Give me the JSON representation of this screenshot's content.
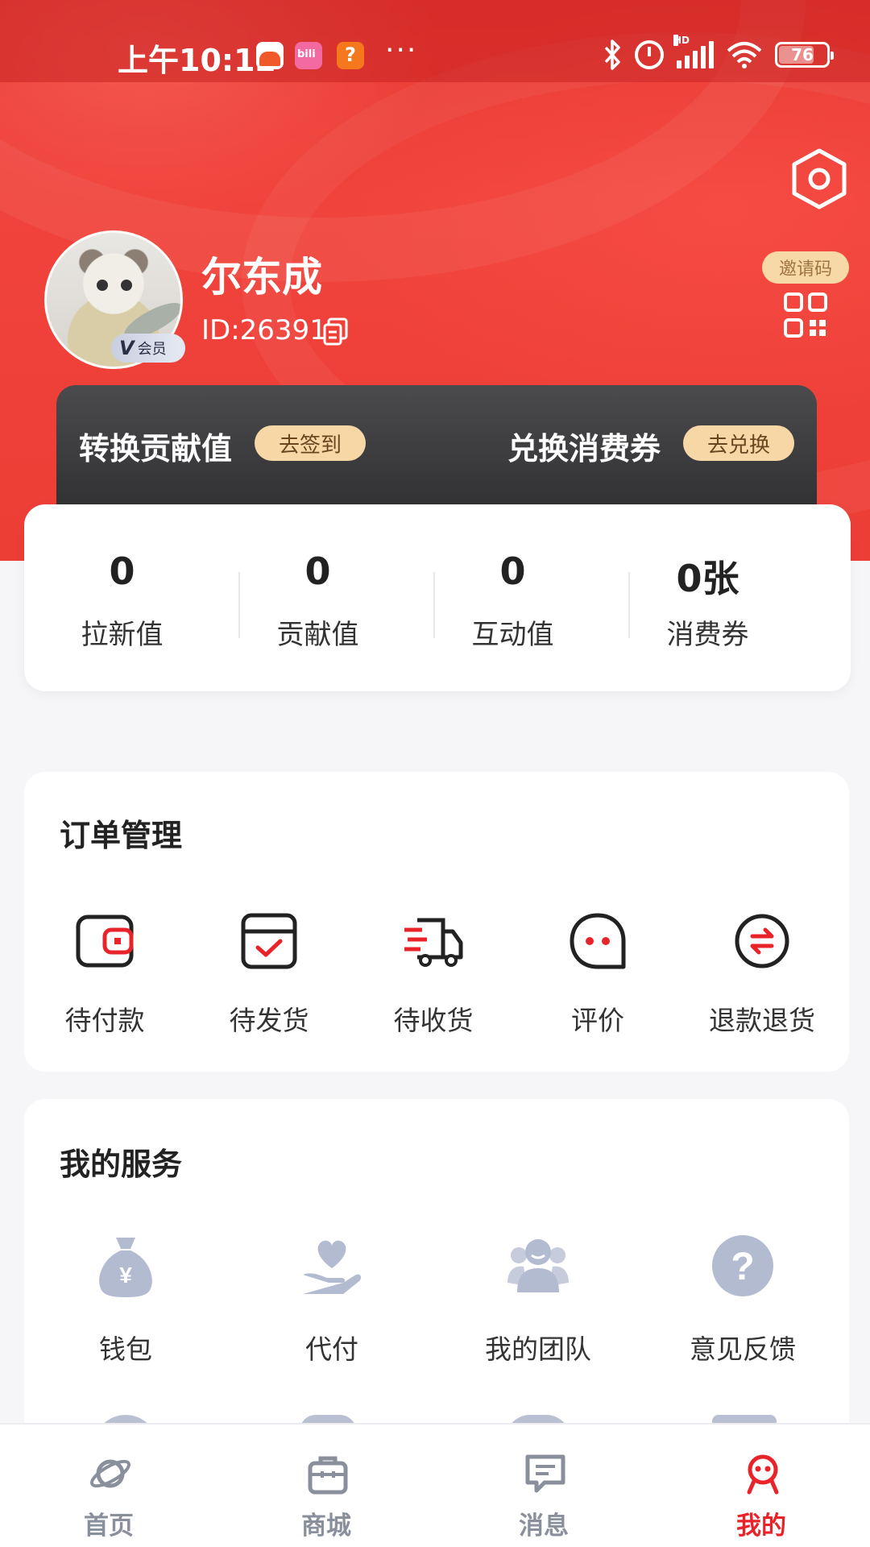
{
  "status_bar": {
    "time": "上午10:12",
    "battery": "76",
    "battery_fraction": 0.76,
    "signal_label": "HD",
    "icons": [
      "app-icon-orange",
      "bilibili-icon",
      "app-icon-question",
      "more-dots-icon",
      "bluetooth-icon",
      "alarm-icon",
      "signal-icon",
      "wifi-icon",
      "battery-icon"
    ]
  },
  "profile": {
    "name": "尔东成",
    "id_text": "ID:26391",
    "vip_letter": "V",
    "vip_label": "会员",
    "invite_label": "邀请码"
  },
  "promo": {
    "left_label": "转换贡献值",
    "left_button": "去签到",
    "right_label": "兑换消费券",
    "right_button": "去兑换"
  },
  "stats": [
    {
      "value": "0",
      "label": "拉新值"
    },
    {
      "value": "0",
      "label": "贡献值"
    },
    {
      "value": "0",
      "label": "互动值"
    },
    {
      "value": "0张",
      "label": "消费券"
    }
  ],
  "orders": {
    "title": "订单管理",
    "items": [
      {
        "label": "待付款",
        "icon": "wallet-icon"
      },
      {
        "label": "待发货",
        "icon": "box-check-icon"
      },
      {
        "label": "待收货",
        "icon": "truck-icon"
      },
      {
        "label": "评价",
        "icon": "chat-bubble-icon"
      },
      {
        "label": "退款退货",
        "icon": "refund-icon"
      }
    ]
  },
  "services": {
    "title": "我的服务",
    "items": [
      {
        "label": "钱包",
        "icon": "money-bag-icon"
      },
      {
        "label": "代付",
        "icon": "heart-hand-icon"
      },
      {
        "label": "我的团队",
        "icon": "team-icon"
      },
      {
        "label": "意见反馈",
        "icon": "question-icon"
      }
    ]
  },
  "nav": [
    {
      "label": "首页",
      "icon": "planet-icon",
      "active": false
    },
    {
      "label": "商城",
      "icon": "shopping-bag-icon",
      "active": false
    },
    {
      "label": "消息",
      "icon": "message-icon",
      "active": false
    },
    {
      "label": "我的",
      "icon": "profile-robot-icon",
      "active": true
    }
  ],
  "colors": {
    "brand_red": "#e8242a",
    "header_red": "#ed3e36",
    "gold": "#f7d7a6",
    "dark_card": "#3a3a3c",
    "icon_gray": "#b3bbd0"
  }
}
